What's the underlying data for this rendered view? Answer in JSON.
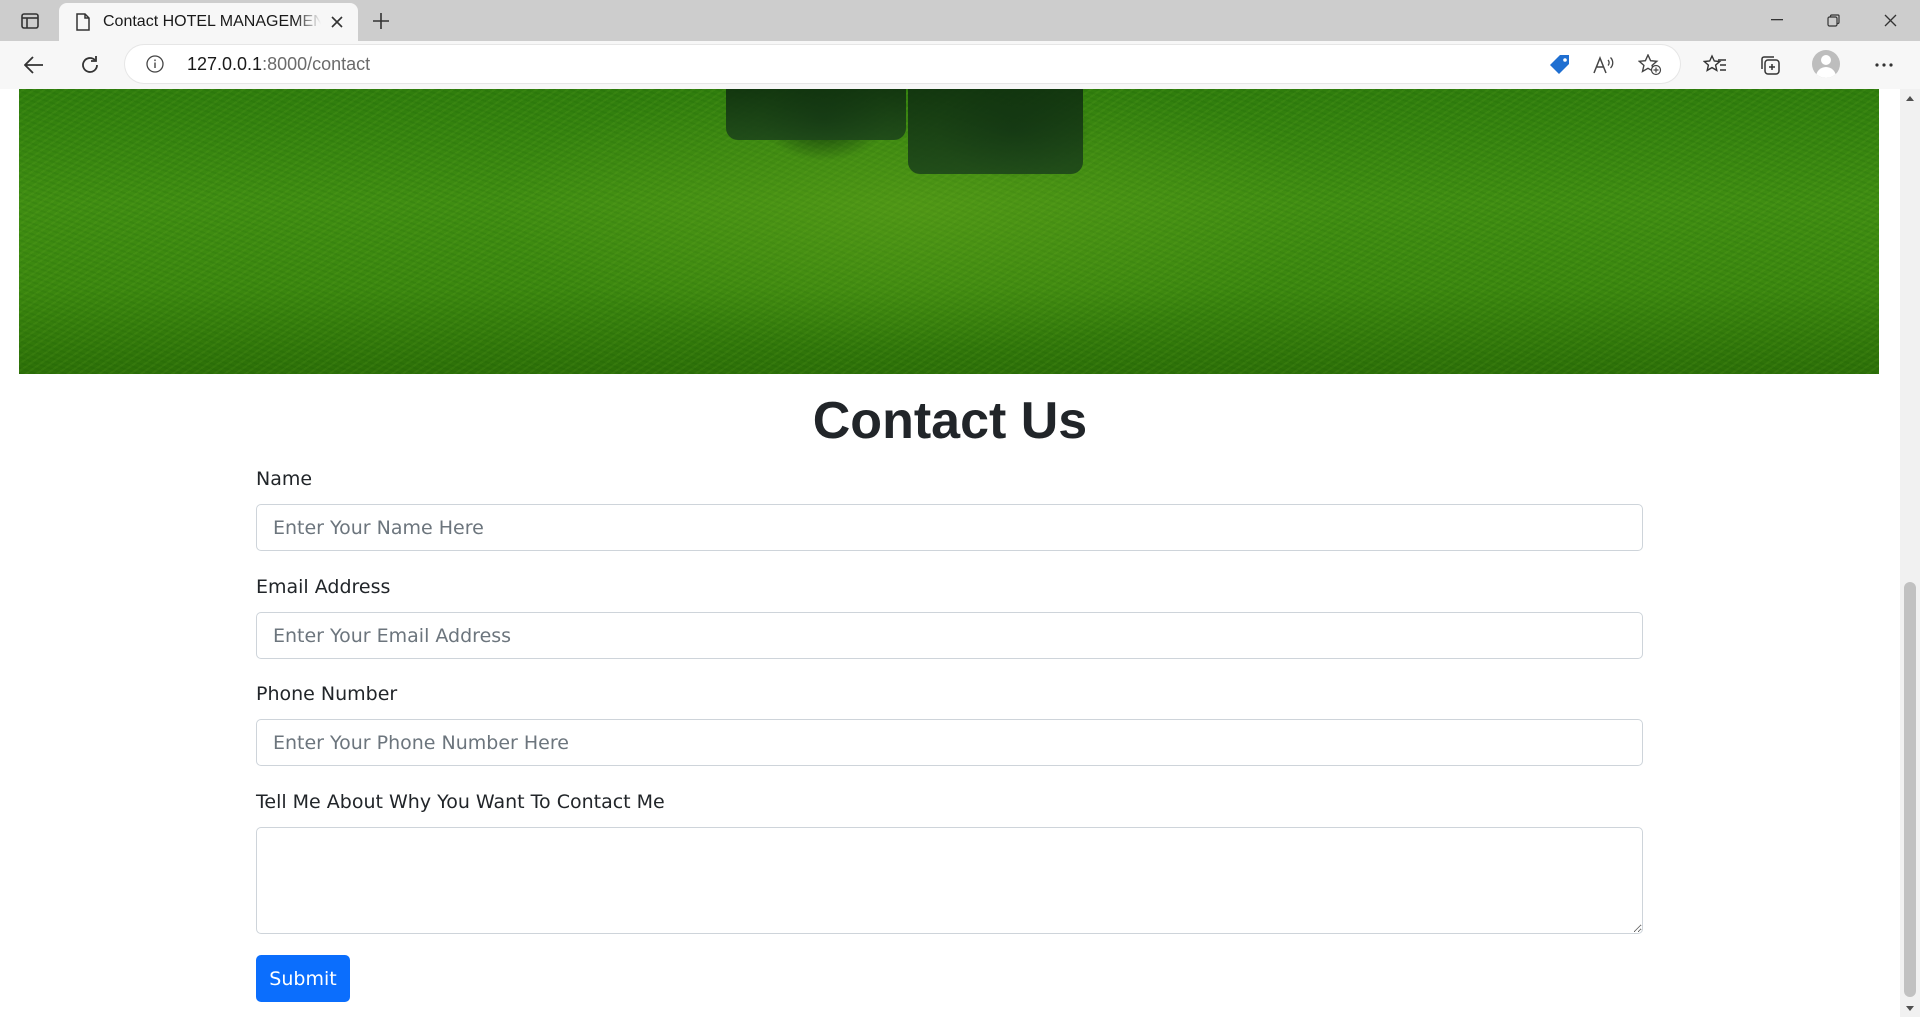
{
  "browser": {
    "tab_title": "Contact HOTEL MANAGEMENT WEBSITE",
    "url_host": "127.0.0.1",
    "url_path": ":8000/contact"
  },
  "page": {
    "heading": "Contact Us",
    "form": {
      "name_label": "Name",
      "name_placeholder": "Enter Your Name Here",
      "email_label": "Email Address",
      "email_placeholder": "Enter Your Email Address",
      "phone_label": "Phone Number",
      "phone_placeholder": "Enter Your Phone Number Here",
      "message_label": "Tell Me About Why You Want To Contact Me",
      "submit_label": "Submit"
    }
  },
  "colors": {
    "primary_button": "#0b6efd",
    "hero_green": "#3f8d12"
  },
  "icons": [
    "sidebar-icon",
    "page-icon",
    "close-icon",
    "plus-icon",
    "back-icon",
    "refresh-icon",
    "info-icon",
    "tag-icon",
    "read-aloud-icon",
    "add-favorite-icon",
    "favorites-icon",
    "collections-icon",
    "profile-icon",
    "more-icon",
    "minimize-icon",
    "restore-icon",
    "window-close-icon"
  ]
}
